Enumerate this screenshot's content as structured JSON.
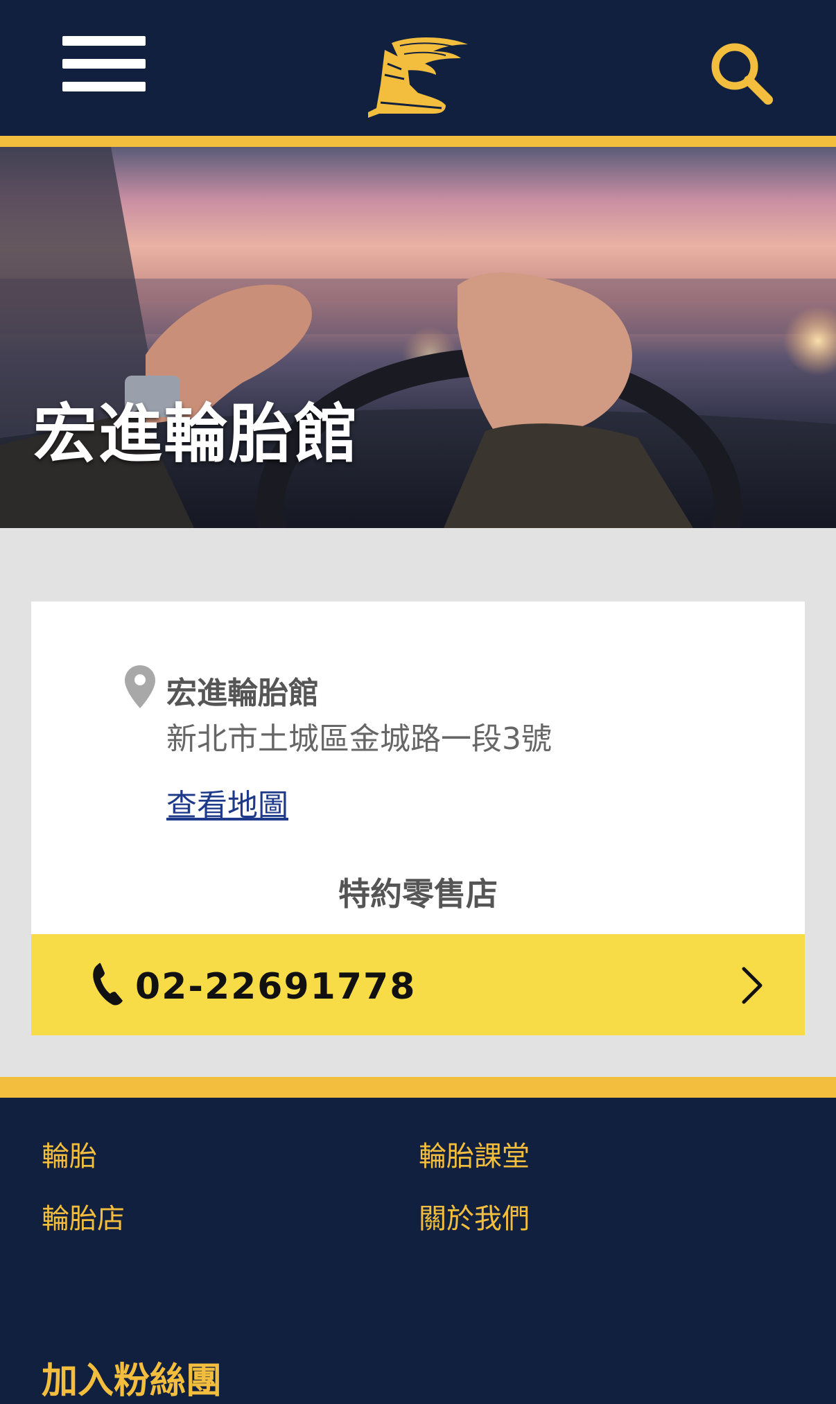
{
  "header": {
    "menu_icon": "hamburger-menu-icon",
    "logo_icon": "winged-foot-logo-icon",
    "search_icon": "search-icon"
  },
  "hero": {
    "title": "宏進輪胎館"
  },
  "store": {
    "name": "宏進輪胎館",
    "address": "新北市土城區金城路一段3號",
    "map_link": "查看地圖",
    "type": "特約零售店",
    "phone": "02-22691778"
  },
  "footer": {
    "links": [
      "輪胎",
      "輪胎課堂",
      "輪胎店",
      "關於我們"
    ],
    "heading": "加入粉絲團"
  },
  "colors": {
    "navy": "#12203f",
    "gold": "#f3be3d",
    "yellow_bar": "#f7dc48",
    "link_blue": "#1f3a8a"
  }
}
